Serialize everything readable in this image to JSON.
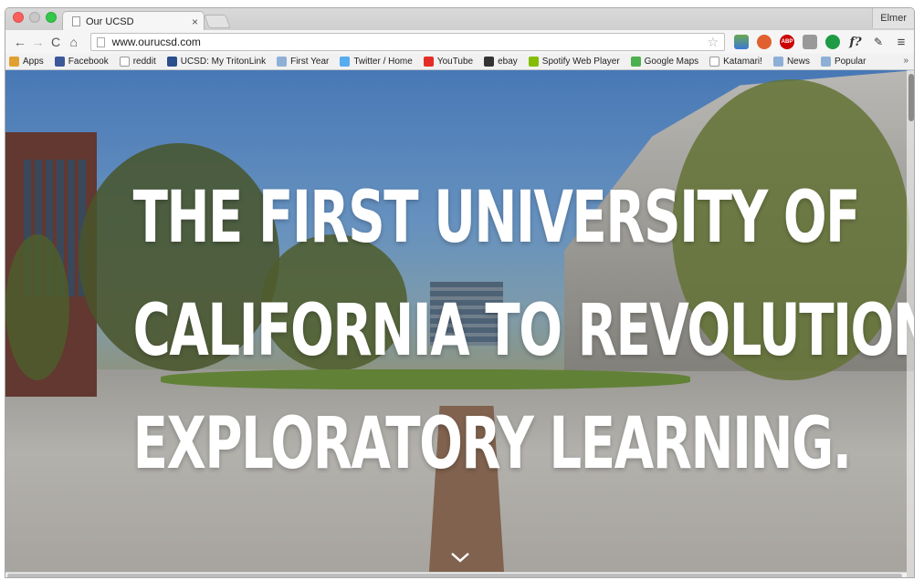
{
  "window": {
    "profile_name": "Elmer"
  },
  "tab": {
    "title": "Our UCSD",
    "close_glyph": "×"
  },
  "toolbar": {
    "back_glyph": "←",
    "forward_glyph": "→",
    "reload_glyph": "C",
    "home_glyph": "⌂",
    "url": "www.ourucsd.com",
    "star_glyph": "☆",
    "extensions": [
      "sheets-icon",
      "shield-icon",
      "adblock-icon",
      "download-icon",
      "green-circle-icon",
      "function-icon",
      "eyedropper-icon"
    ],
    "abp_label": "ABP",
    "f_label": "f?",
    "menu_glyph": "≡"
  },
  "bookmarks": {
    "items": [
      {
        "label": "Apps",
        "icon": "apps-icon",
        "color": "#e0a030"
      },
      {
        "label": "Facebook",
        "icon": "facebook-icon",
        "color": "#3b5998"
      },
      {
        "label": "reddit",
        "icon": "reddit-icon",
        "color": "#ffffff"
      },
      {
        "label": "UCSD: My TritonLink",
        "icon": "triton-icon",
        "color": "#2a4f8c"
      },
      {
        "label": "First Year",
        "icon": "folder-icon",
        "color": "#8fb0d6"
      },
      {
        "label": "Twitter / Home",
        "icon": "twitter-icon",
        "color": "#55acee"
      },
      {
        "label": "YouTube",
        "icon": "youtube-icon",
        "color": "#e52d27"
      },
      {
        "label": "ebay",
        "icon": "ebay-icon",
        "color": "#333333"
      },
      {
        "label": "Spotify Web Player",
        "icon": "spotify-icon",
        "color": "#84bd00"
      },
      {
        "label": "Google Maps",
        "icon": "maps-icon",
        "color": "#4caf50"
      },
      {
        "label": "Katamari!",
        "icon": "page-icon",
        "color": "#ffffff"
      },
      {
        "label": "News",
        "icon": "folder-icon",
        "color": "#8fb0d6"
      },
      {
        "label": "Popular",
        "icon": "folder-icon",
        "color": "#8fb0d6"
      }
    ],
    "overflow_glyph": "»"
  },
  "hero": {
    "line1": "THE FIRST UNIVERSITY OF",
    "line2": "CALIFORNIA TO REVOLUTIONIZE",
    "line3": "EXPLORATORY LEARNING."
  }
}
